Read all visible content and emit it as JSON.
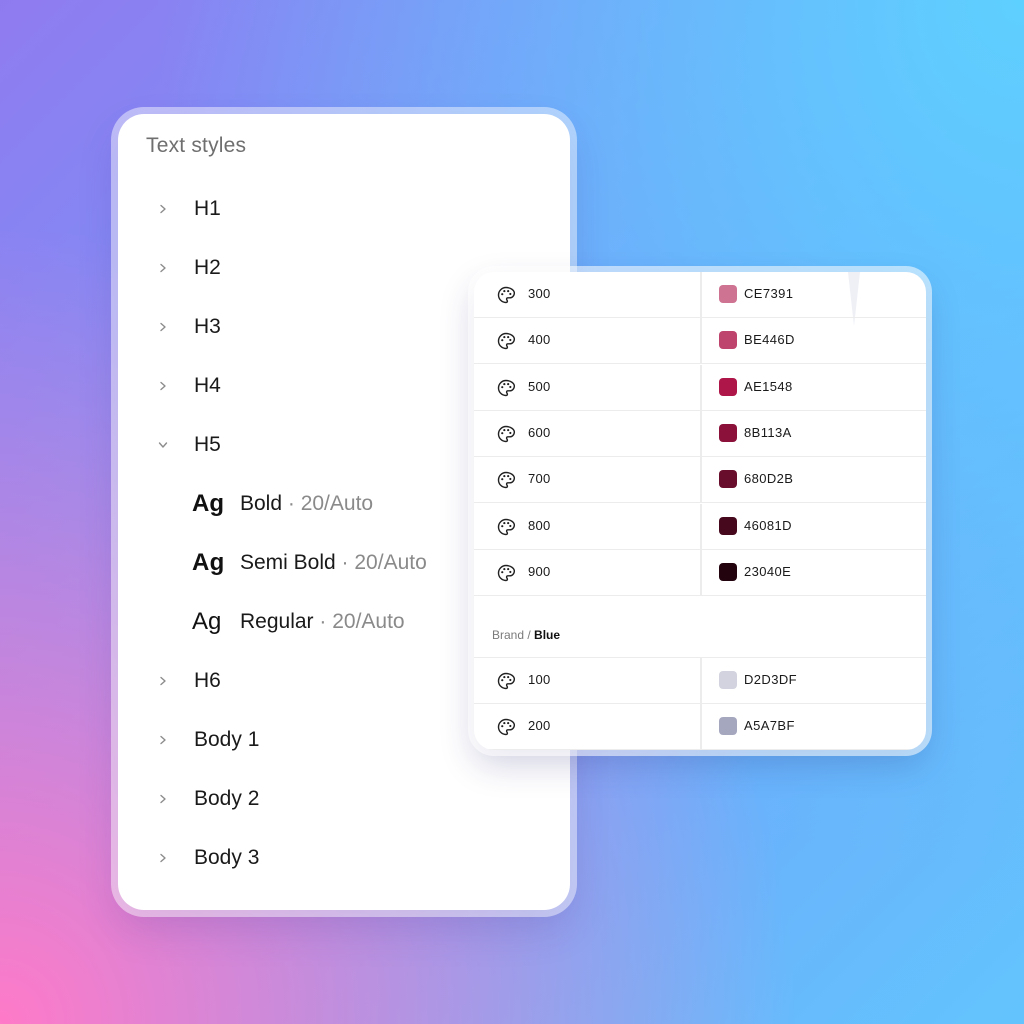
{
  "text_styles": {
    "title": "Text styles",
    "items_before": [
      {
        "label": "H1"
      },
      {
        "label": "H2"
      },
      {
        "label": "H3"
      },
      {
        "label": "H4"
      }
    ],
    "expanded": {
      "label": "H5",
      "styles": [
        {
          "sample": "Ag",
          "name": "Bold",
          "spec": " · 20/Auto"
        },
        {
          "sample": "Ag",
          "name": "Semi Bold",
          "spec": " · 20/Auto"
        },
        {
          "sample": "Ag",
          "name": "Regular",
          "spec": " · 20/Auto"
        }
      ]
    },
    "items_after": [
      {
        "label": "H6"
      },
      {
        "label": "Body 1"
      },
      {
        "label": "Body 2"
      },
      {
        "label": "Body 3"
      }
    ]
  },
  "colors": {
    "icon": "palette-icon",
    "rows_top": [
      {
        "shade": "300",
        "hex": "CE7391",
        "color": "#CE7391"
      },
      {
        "shade": "400",
        "hex": "BE446D",
        "color": "#BE446D"
      },
      {
        "shade": "500",
        "hex": "AE1548",
        "color": "#AE1548"
      },
      {
        "shade": "600",
        "hex": "8B113A",
        "color": "#8B113A"
      },
      {
        "shade": "700",
        "hex": "680D2B",
        "color": "#680D2B"
      },
      {
        "shade": "800",
        "hex": "46081D",
        "color": "#46081D"
      },
      {
        "shade": "900",
        "hex": "23040E",
        "color": "#23040E"
      }
    ],
    "group": {
      "prefix": "Brand / ",
      "name": "Blue"
    },
    "rows_bottom": [
      {
        "shade": "100",
        "hex": "D2D3DF",
        "color": "#D2D3DF"
      },
      {
        "shade": "200",
        "hex": "A5A7BF",
        "color": "#A5A7BF"
      }
    ]
  }
}
